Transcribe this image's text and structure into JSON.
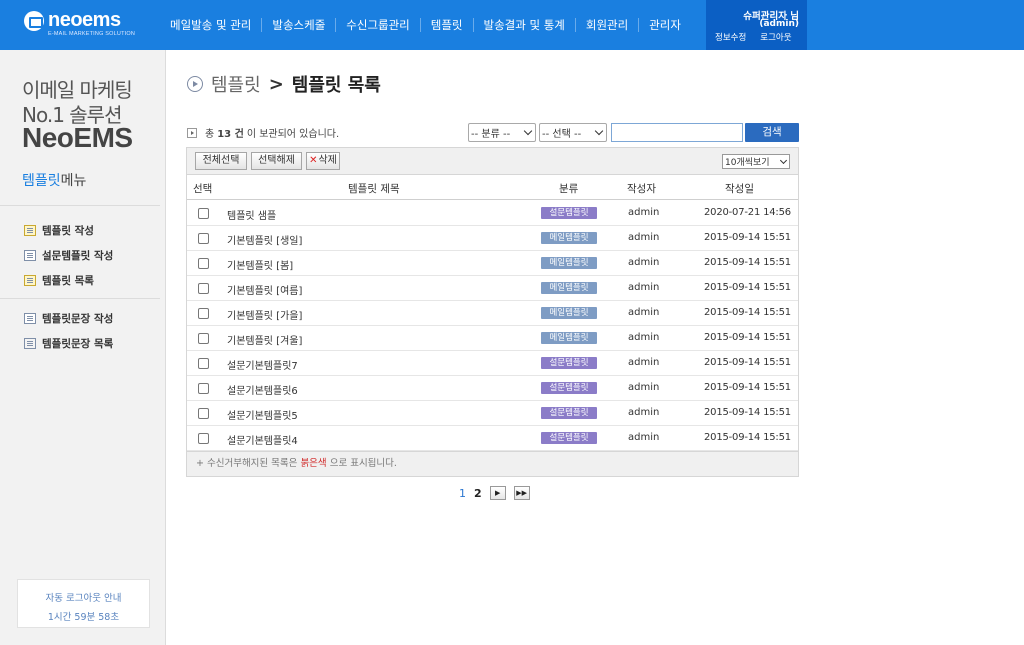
{
  "header": {
    "logo": {
      "name": "neoems",
      "tagline": "E-MAIL MARKETING SOLUTION"
    },
    "nav": [
      "메일발송 및 관리",
      "발송스케줄",
      "수신그룹관리",
      "템플릿",
      "발송결과 및 통계",
      "회원관리",
      "관리자"
    ],
    "user": {
      "name": "슈퍼관리자 님",
      "id": "(admin)",
      "edit_info": "정보수정",
      "logout": "로그아웃"
    }
  },
  "sidebar": {
    "brand_line1": "이메일 마케팅",
    "brand_line2": "No.1 솔루션",
    "brand_line3": "NeoEMS",
    "menu_title_highlight": "템플릿",
    "menu_title_rest": "메뉴",
    "items": [
      "템플릿 작성",
      "설문템플릿 작성",
      "템플릿 목록",
      "템플릿문장 작성",
      "템플릿문장 목록"
    ],
    "logout_notice": "자동 로그아웃 안내",
    "logout_timer": "1시간 59분 58초"
  },
  "main": {
    "breadcrumb_parent": "템플릿",
    "breadcrumb_sep": ">",
    "page_title": "템플릿 목록",
    "count_prefix": "총",
    "count_value": "13 건",
    "count_suffix": "이 보관되어 있습니다.",
    "filter_category": "-- 분류 --",
    "filter_select": "-- 선택 --",
    "search_value": "",
    "search_button": "검색",
    "toolbar": {
      "select_all": "전체선택",
      "deselect": "선택해제",
      "delete": "삭제",
      "per_page": "10개씩보기"
    },
    "columns": {
      "select": "선택",
      "title": "템플릿 제목",
      "category": "분류",
      "author": "작성자",
      "date": "작성일"
    },
    "rows": [
      {
        "title": "템플릿 샘플",
        "category": "설문템플릿",
        "author": "admin",
        "date": "2020-07-21 14:56"
      },
      {
        "title": "기본템플릿 [생일]",
        "category": "메일템플릿",
        "author": "admin",
        "date": "2015-09-14 15:51"
      },
      {
        "title": "기본템플릿 [봄]",
        "category": "메일템플릿",
        "author": "admin",
        "date": "2015-09-14 15:51"
      },
      {
        "title": "기본템플릿 [여름]",
        "category": "메일템플릿",
        "author": "admin",
        "date": "2015-09-14 15:51"
      },
      {
        "title": "기본템플릿 [가을]",
        "category": "메일템플릿",
        "author": "admin",
        "date": "2015-09-14 15:51"
      },
      {
        "title": "기본템플릿 [겨울]",
        "category": "메일템플릿",
        "author": "admin",
        "date": "2015-09-14 15:51"
      },
      {
        "title": "설문기본템플릿7",
        "category": "설문템플릿",
        "author": "admin",
        "date": "2015-09-14 15:51"
      },
      {
        "title": "설문기본템플릿6",
        "category": "설문템플릿",
        "author": "admin",
        "date": "2015-09-14 15:51"
      },
      {
        "title": "설문기본템플릿5",
        "category": "설문템플릿",
        "author": "admin",
        "date": "2015-09-14 15:51"
      },
      {
        "title": "설문기본템플릿4",
        "category": "설문템플릿",
        "author": "admin",
        "date": "2015-09-14 15:51"
      }
    ],
    "note_prefix": "+ 수신거부해지된 목록은",
    "note_red": "붉은색",
    "note_suffix": "으로 표시됩니다.",
    "pagination": {
      "pages": [
        "1",
        "2"
      ],
      "current": "1",
      "next": "▶",
      "last": "▶▶"
    }
  },
  "colors": {
    "header_bg": "#1a7fe0",
    "user_box_bg": "#0b5fc4",
    "survey_badge": "#8b7cc8",
    "mail_badge": "#7e9cc4",
    "search_button": "#2b6bbf"
  }
}
